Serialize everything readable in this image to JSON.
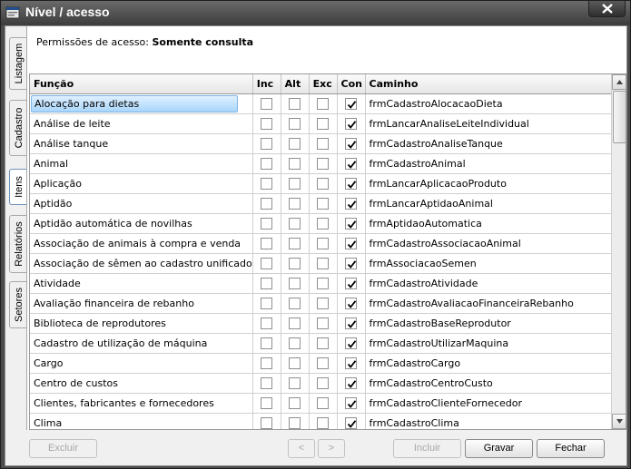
{
  "window": {
    "title": "Nível / acesso"
  },
  "tabs": [
    {
      "label": "Listagem",
      "active": false
    },
    {
      "label": "Cadastro",
      "active": false
    },
    {
      "label": "Itens",
      "active": true
    },
    {
      "label": "Relatórios",
      "active": false
    },
    {
      "label": "Setores",
      "active": false
    }
  ],
  "permission": {
    "label": "Permissões de acesso:",
    "value": "Somente consulta"
  },
  "grid": {
    "columns": [
      "Função",
      "Inc",
      "Alt",
      "Exc",
      "Con",
      "Caminho"
    ],
    "rows": [
      {
        "funcao": "Alocação para dietas",
        "inc": false,
        "alt": false,
        "exc": false,
        "con": true,
        "caminho": "frmCadastroAlocacaoDieta",
        "selected": true
      },
      {
        "funcao": "Análise de leite",
        "inc": false,
        "alt": false,
        "exc": false,
        "con": true,
        "caminho": "frmLancarAnaliseLeiteIndividual"
      },
      {
        "funcao": "Análise tanque",
        "inc": false,
        "alt": false,
        "exc": false,
        "con": true,
        "caminho": "frmCadastroAnaliseTanque"
      },
      {
        "funcao": "Animal",
        "inc": false,
        "alt": false,
        "exc": false,
        "con": true,
        "caminho": "frmCadastroAnimal"
      },
      {
        "funcao": "Aplicação",
        "inc": false,
        "alt": false,
        "exc": false,
        "con": true,
        "caminho": "frmLancarAplicacaoProduto"
      },
      {
        "funcao": "Aptidão",
        "inc": false,
        "alt": false,
        "exc": false,
        "con": true,
        "caminho": "frmLancarAptidaoAnimal"
      },
      {
        "funcao": "Aptidão automática de novilhas",
        "inc": false,
        "alt": false,
        "exc": false,
        "con": true,
        "caminho": "frmAptidaoAutomatica"
      },
      {
        "funcao": "Associação de animais à compra e venda",
        "inc": false,
        "alt": false,
        "exc": false,
        "con": true,
        "caminho": "frmCadastroAssociacaoAnimal"
      },
      {
        "funcao": "Associação de sêmen ao cadastro unificado",
        "inc": false,
        "alt": false,
        "exc": false,
        "con": true,
        "caminho": "frmAssociacaoSemen"
      },
      {
        "funcao": "Atividade",
        "inc": false,
        "alt": false,
        "exc": false,
        "con": true,
        "caminho": "frmCadastroAtividade"
      },
      {
        "funcao": "Avaliação financeira de rebanho",
        "inc": false,
        "alt": false,
        "exc": false,
        "con": true,
        "caminho": "frmCadastroAvaliacaoFinanceiraRebanho"
      },
      {
        "funcao": "Biblioteca de reprodutores",
        "inc": false,
        "alt": false,
        "exc": false,
        "con": true,
        "caminho": "frmCadastroBaseReprodutor"
      },
      {
        "funcao": "Cadastro de utilização de máquina",
        "inc": false,
        "alt": false,
        "exc": false,
        "con": true,
        "caminho": "frmCadastroUtilizarMaquina"
      },
      {
        "funcao": "Cargo",
        "inc": false,
        "alt": false,
        "exc": false,
        "con": true,
        "caminho": "frmCadastroCargo"
      },
      {
        "funcao": "Centro de custos",
        "inc": false,
        "alt": false,
        "exc": false,
        "con": true,
        "caminho": "frmCadastroCentroCusto"
      },
      {
        "funcao": "Clientes, fabricantes e fornecedores",
        "inc": false,
        "alt": false,
        "exc": false,
        "con": true,
        "caminho": "frmCadastroClienteFornecedor"
      },
      {
        "funcao": "Clima",
        "inc": false,
        "alt": false,
        "exc": false,
        "con": true,
        "caminho": "frmCadastroClima"
      }
    ]
  },
  "buttons": {
    "excluir": {
      "label": "Excluir",
      "disabled": true
    },
    "prev": {
      "label": "<",
      "disabled": true
    },
    "next": {
      "label": ">",
      "disabled": true
    },
    "incluir": {
      "label": "Incluir",
      "disabled": true
    },
    "gravar": {
      "label": "Gravar",
      "disabled": false
    },
    "fechar": {
      "label": "Fechar",
      "disabled": false
    }
  }
}
